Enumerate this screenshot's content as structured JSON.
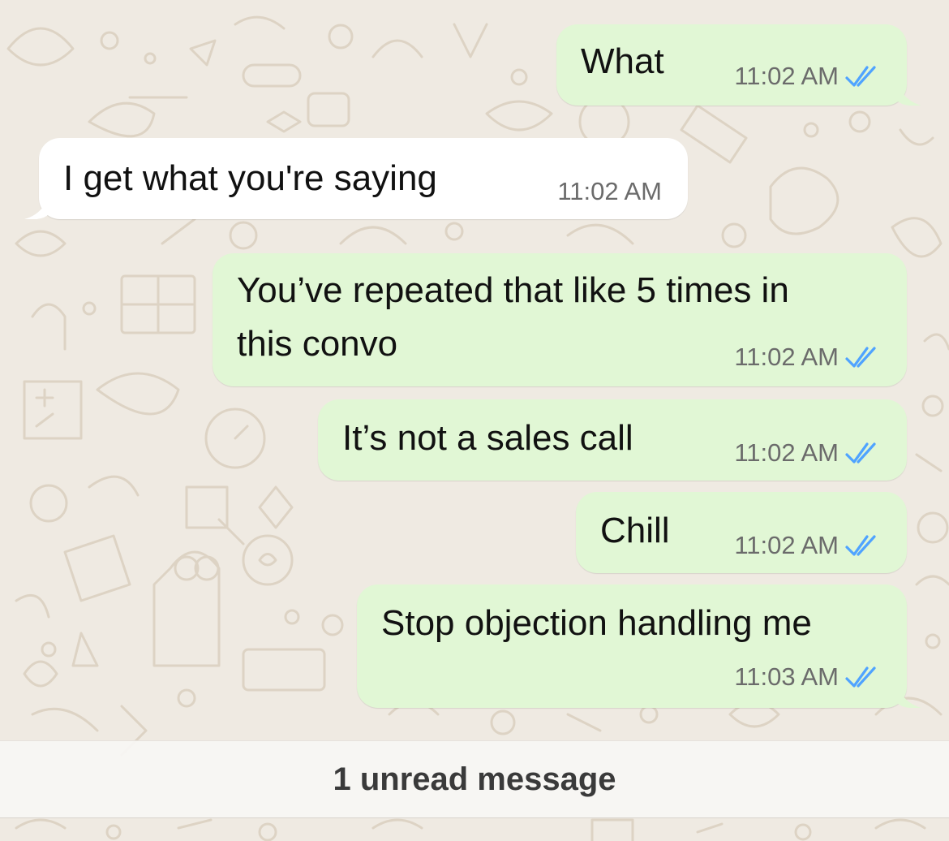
{
  "colors": {
    "wallpaper": "#efeae2",
    "outgoing_bubble": "#e1f7d5",
    "incoming_bubble": "#ffffff",
    "read_ticks": "#4fa3ff",
    "timestamp": "#6b6b6b"
  },
  "messages": [
    {
      "direction": "outgoing",
      "text": "What",
      "time": "11:02 AM",
      "status_icon": "double-check-read-icon"
    },
    {
      "direction": "incoming",
      "text": "I get what you're saying",
      "time": "11:02 AM"
    },
    {
      "direction": "outgoing",
      "lines": [
        "You’ve repeated that like 5 times in",
        "this convo"
      ],
      "time": "11:02 AM",
      "status_icon": "double-check-read-icon"
    },
    {
      "direction": "outgoing",
      "text": "It’s not a sales call",
      "time": "11:02 AM",
      "status_icon": "double-check-read-icon"
    },
    {
      "direction": "outgoing",
      "text": "Chill",
      "time": "11:02 AM",
      "status_icon": "double-check-read-icon"
    },
    {
      "direction": "outgoing",
      "text": "Stop objection handling me",
      "time": "11:03 AM",
      "status_icon": "double-check-read-icon"
    }
  ],
  "unread_divider": {
    "label": "1 unread message"
  }
}
